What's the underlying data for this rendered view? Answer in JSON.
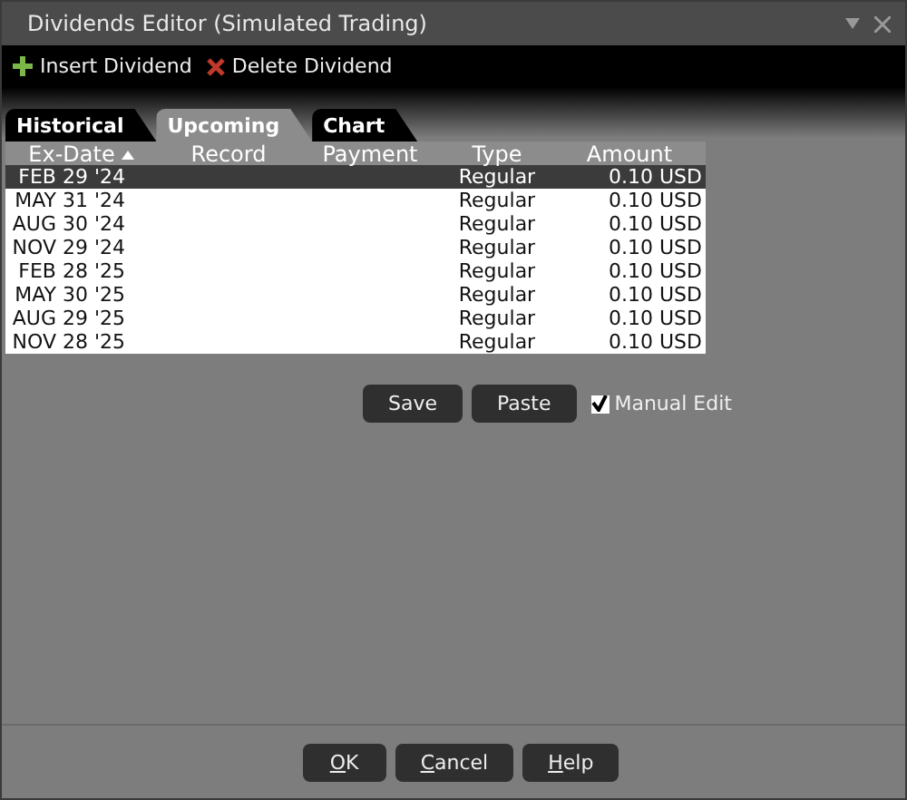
{
  "window": {
    "title": "Dividends Editor (Simulated Trading)"
  },
  "toolbar": [
    {
      "kind": "insert",
      "label": "Insert Dividend"
    },
    {
      "kind": "delete",
      "label": "Delete Dividend"
    }
  ],
  "tabs": [
    {
      "label": "Historical",
      "selected": false
    },
    {
      "label": "Upcoming",
      "selected": true
    },
    {
      "label": "Chart",
      "selected": false
    }
  ],
  "table": {
    "columns": [
      {
        "label": "Ex-Date",
        "sorted": true
      },
      {
        "label": "Record",
        "sorted": false
      },
      {
        "label": "Payment",
        "sorted": false
      },
      {
        "label": "Type",
        "sorted": false
      },
      {
        "label": "Amount",
        "sorted": false
      }
    ],
    "rows": [
      {
        "ex_date": "FEB 29 '24",
        "type": "Regular",
        "amount": "0.10 USD",
        "selected": true
      },
      {
        "ex_date": "MAY 31 '24",
        "type": "Regular",
        "amount": "0.10 USD",
        "selected": false
      },
      {
        "ex_date": "AUG 30 '24",
        "type": "Regular",
        "amount": "0.10 USD",
        "selected": false
      },
      {
        "ex_date": "NOV 29 '24",
        "type": "Regular",
        "amount": "0.10 USD",
        "selected": false
      },
      {
        "ex_date": "FEB 28 '25",
        "type": "Regular",
        "amount": "0.10 USD",
        "selected": false
      },
      {
        "ex_date": "MAY 30 '25",
        "type": "Regular",
        "amount": "0.10 USD",
        "selected": false
      },
      {
        "ex_date": "AUG 29 '25",
        "type": "Regular",
        "amount": "0.10 USD",
        "selected": false
      },
      {
        "ex_date": "NOV 28 '25",
        "type": "Regular",
        "amount": "0.10 USD",
        "selected": false
      }
    ]
  },
  "actions": [
    "Save",
    "Paste"
  ],
  "manual_edit": {
    "label": "Manual Edit",
    "checked": true
  },
  "dialog_buttons": [
    "OK",
    "Cancel",
    "Help"
  ]
}
